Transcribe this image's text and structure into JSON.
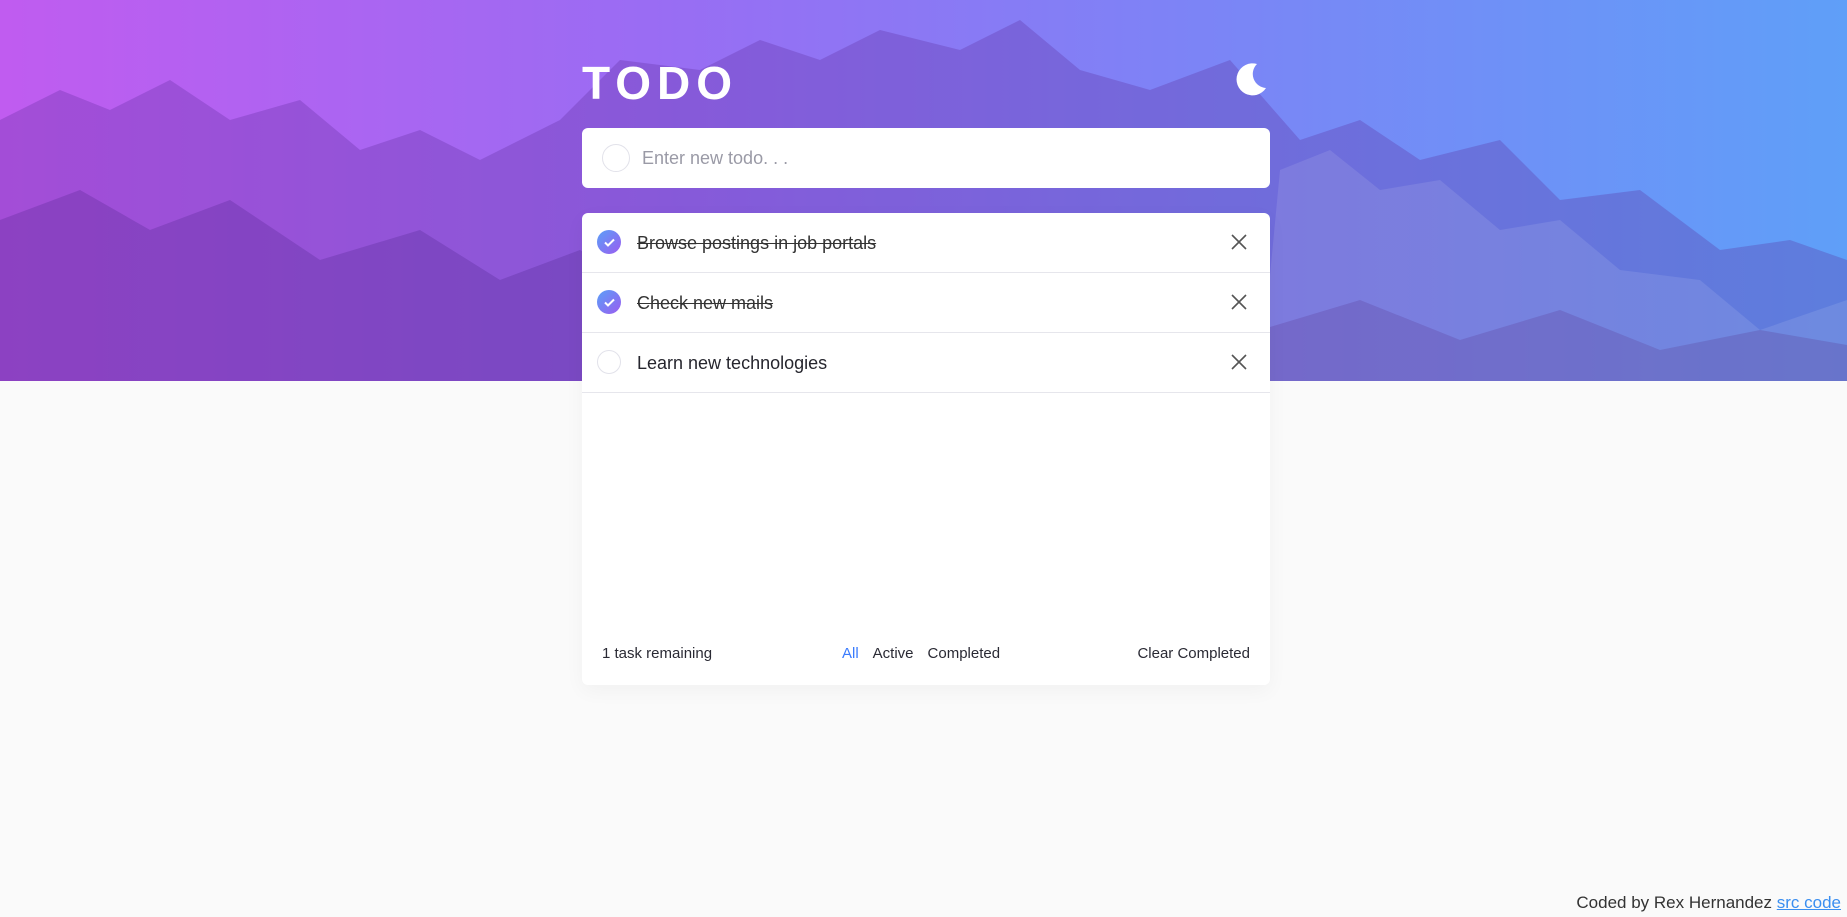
{
  "app": {
    "title": "TODO",
    "theme_toggle_icon": "moon-icon"
  },
  "new_todo": {
    "placeholder": "Enter new todo. . ."
  },
  "todos": [
    {
      "text": "Browse postings in job portals",
      "completed": true
    },
    {
      "text": "Check new mails",
      "completed": true
    },
    {
      "text": "Learn new technologies",
      "completed": false
    }
  ],
  "footer": {
    "remaining": "1 task remaining",
    "filters": [
      "All",
      "Active",
      "Completed"
    ],
    "active_filter": "All",
    "clear_label": "Clear Completed"
  },
  "credit": {
    "text": "Coded by Rex Hernandez",
    "link_text": "src code"
  },
  "colors": {
    "accent": "#3a7bfd",
    "check_gradient_start": "#5aa0f8",
    "check_gradient_end": "#9b5cf0",
    "hero_left": "#c05cf0",
    "hero_right": "#5f9ff8",
    "background": "#fafafa"
  }
}
